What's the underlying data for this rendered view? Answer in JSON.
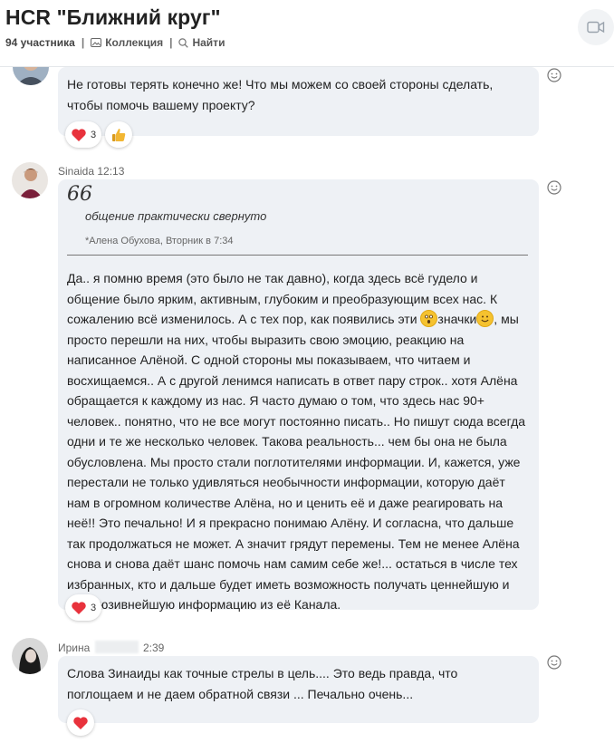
{
  "header": {
    "title": "HCR \"Ближний круг\"",
    "participants": "94 участника",
    "collection": "Коллекция",
    "find": "Найти"
  },
  "messages": [
    {
      "text": "Не готовы терять конечно же! Что мы можем со своей стороны сделать, чтобы помочь вашему проекту?",
      "reactions": [
        {
          "icon": "heart-icon",
          "count": "3"
        },
        {
          "icon": "thumbs-up-icon"
        }
      ]
    },
    {
      "author": "Sinaida",
      "time": "12:13",
      "quote": {
        "text": "общение практически свернуто",
        "author": "*Алена Обухова, Вторник в 7:34"
      },
      "text_parts": [
        "Да.. я помню время (это было не так давно), когда здесь всё гудело и общение было ярким, активным, глубоким и преобразующим всех нас. К сожалению всё изменилось. А с тех пор, как появились эти ",
        "значки",
        ", мы просто перешли на них, чтобы выразить свою эмоцию, реакцию на написанное Алёной. С одной стороны мы показываем, что читаем и восхищаемся.. А с другой ленимся написать в ответ пару строк.. хотя Алёна обращается к каждому из нас. Я часто думаю о том, что здесь нас 90+ человек.. понятно, что не все могут постоянно писать.. Но пишут сюда всегда одни и те же несколько человек. Такова реальность... чем бы она не была обусловлена. Мы просто стали поглотителями информации. И, кажется, уже перестали не только удивляться необычности информации, которую даёт нам в огромном количестве Алёна, но и ценить её и даже реагировать на неё!! Это печально! И я прекрасно понимаю Алёну. И согласна, что дальше так продолжаться не может. А значит грядут перемены. Тем не менее Алёна снова и снова даёт шанс помочь нам самим себе же!... остаться в числе тех избранных, кто и дальше будет иметь возможность получать ценнейшую и эксклюзивнейшую информацию из её Канала."
      ],
      "reactions": [
        {
          "icon": "heart-icon",
          "count": "3"
        }
      ]
    },
    {
      "author": "Ирина",
      "time": "2:39",
      "text": "Слова Зинаиды как точные стрелы в цель.... Это ведь правда,  что поглощаем и не даем обратной связи ... Печально очень...",
      "reactions": [
        {
          "icon": "heart-icon"
        }
      ]
    }
  ],
  "colors": {
    "bubble": "#eef1f5",
    "heart": "#e8323c",
    "thumb": "#f2b632"
  }
}
